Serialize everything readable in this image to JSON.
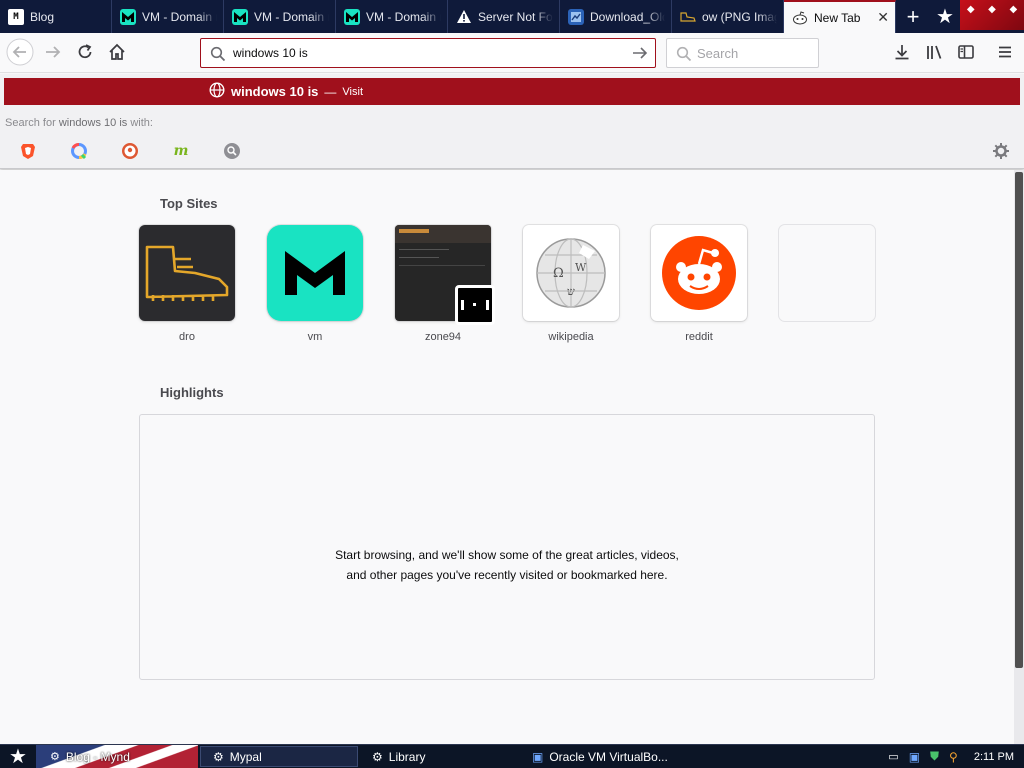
{
  "tabs": [
    {
      "label": "Blog",
      "icon": "medium-icon"
    },
    {
      "label": "VM - Domain m",
      "icon": "vm-icon"
    },
    {
      "label": "VM - Domain m",
      "icon": "vm-icon"
    },
    {
      "label": "VM - Domain m",
      "icon": "vm-icon"
    },
    {
      "label": "Server Not Fo",
      "icon": "warning-icon"
    },
    {
      "label": "Download_Old",
      "icon": "download-page-icon"
    },
    {
      "label": "ow (PNG Image",
      "icon": "boot-image-icon"
    },
    {
      "label": "New Tab",
      "icon": "reddit-alien-icon"
    }
  ],
  "urlbar": {
    "value": "windows 10 is"
  },
  "searchbar": {
    "placeholder": "Search"
  },
  "autocomplete": {
    "title": "windows 10 is",
    "separator": "—",
    "action": "Visit",
    "search_with_prefix": "Search for",
    "search_with_query": "windows 10 is",
    "search_with_suffix": "with:"
  },
  "engines": [
    "brave-icon",
    "qwant-icon",
    "duckduckgo-icon",
    "mojeek-icon",
    "search-engine-icon"
  ],
  "top_sites": {
    "title": "Top Sites",
    "items": [
      {
        "label": "dro"
      },
      {
        "label": "vm"
      },
      {
        "label": "zone94"
      },
      {
        "label": "wikipedia"
      },
      {
        "label": "reddit"
      },
      {
        "label": ""
      }
    ]
  },
  "highlights": {
    "title": "Highlights",
    "message": "Start browsing, and we'll show some of the great articles, videos, and other pages you've recently visited or bookmarked here."
  },
  "taskbar": {
    "items": [
      {
        "label": "Blog - Mynd"
      },
      {
        "label": "Mypal"
      },
      {
        "label": "Library"
      },
      {
        "label": "Oracle VM VirtualBo..."
      }
    ],
    "clock": "2:11 PM"
  },
  "colors": {
    "accent": "#a0101c",
    "tabstrip": "#0f1a3a",
    "vm_brand": "#19e3c2",
    "reddit": "#ff4500"
  }
}
